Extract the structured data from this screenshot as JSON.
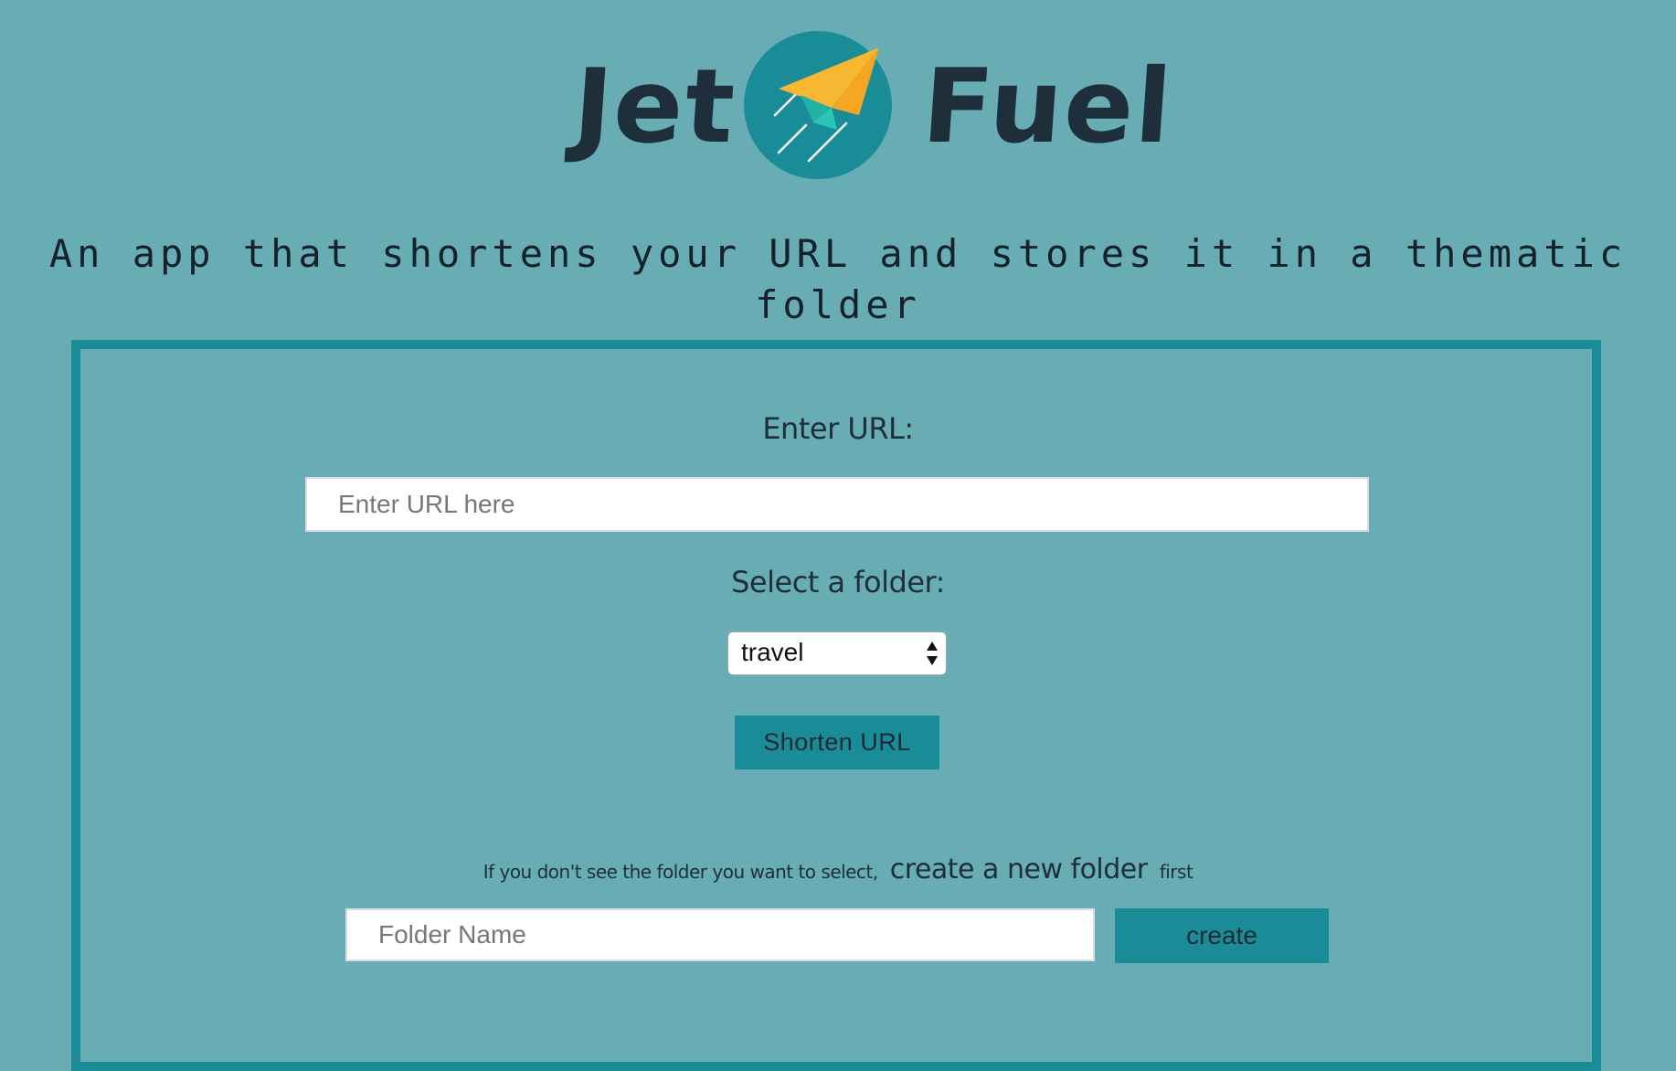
{
  "header": {
    "brand_left": "Jet",
    "brand_right": "Fuel",
    "logo_icon": "paper-plane-icon",
    "tagline": "An app that shortens your URL and stores it in a thematic folder"
  },
  "form": {
    "url_label": "Enter URL:",
    "url_placeholder": "Enter URL here",
    "url_value": "",
    "folder_label": "Select a folder:",
    "folder_selected": "travel",
    "shorten_button": "Shorten URL"
  },
  "new_folder": {
    "hint_prefix": "If you don't see the folder you want to select,",
    "hint_emphasis": "create a new folder",
    "hint_suffix": "first",
    "placeholder": "Folder Name",
    "create_button": "create"
  },
  "colors": {
    "background": "#69adb4",
    "accent": "#1a8c98",
    "text": "#1e2e3a",
    "plane_yellow": "#f7b733",
    "plane_teal": "#2bc5b4"
  }
}
